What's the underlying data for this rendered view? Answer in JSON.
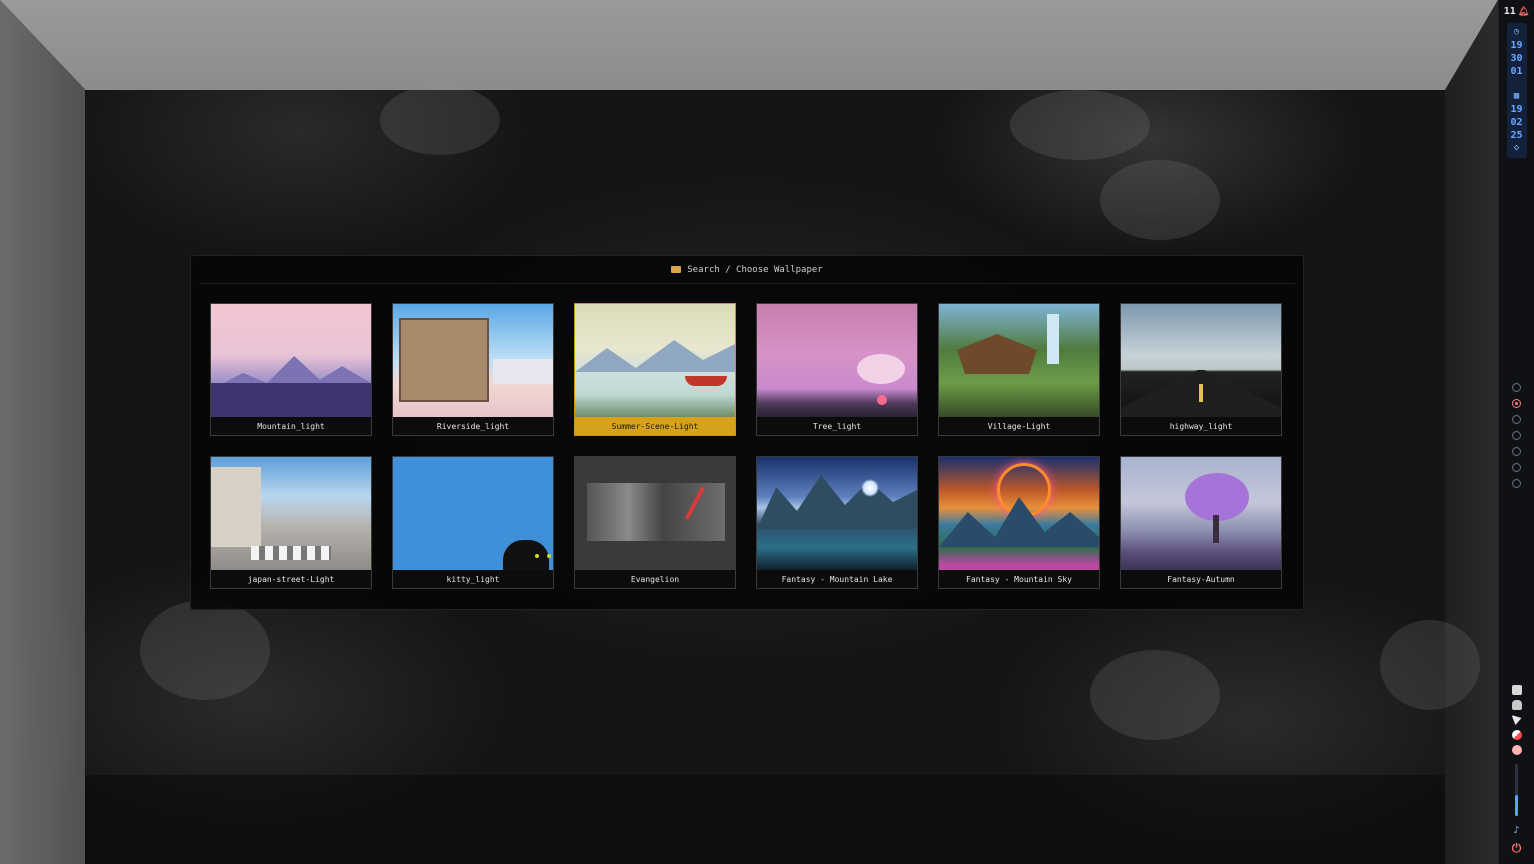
{
  "window": {
    "header_title": "Search / Choose Wallpaper"
  },
  "wallpapers": [
    {
      "label": "Mountain_light",
      "thumb": "t-mountain",
      "selected": false
    },
    {
      "label": "Riverside_light",
      "thumb": "t-riverside",
      "selected": false
    },
    {
      "label": "Summer-Scene-Light",
      "thumb": "t-summer",
      "selected": true
    },
    {
      "label": "Tree_light",
      "thumb": "t-tree",
      "selected": false
    },
    {
      "label": "Village-Light",
      "thumb": "t-village",
      "selected": false
    },
    {
      "label": "highway_light",
      "thumb": "t-highway",
      "selected": false
    },
    {
      "label": "japan-street-Light",
      "thumb": "t-japan",
      "selected": false
    },
    {
      "label": "kitty_light",
      "thumb": "t-kitty",
      "selected": false
    },
    {
      "label": "Evangelion",
      "thumb": "t-evangelion",
      "selected": false
    },
    {
      "label": "Fantasy - Mountain Lake",
      "thumb": "t-lake",
      "selected": false
    },
    {
      "label": "Fantasy - Mountain Sky",
      "thumb": "t-sky",
      "selected": false
    },
    {
      "label": "Fantasy-Autumn",
      "thumb": "t-autumn",
      "selected": false
    }
  ],
  "bar": {
    "workspace_count": "11",
    "bell_icon": "bell-icon",
    "clock_icon": "◷",
    "time": [
      "19",
      "30",
      "01"
    ],
    "calendar_icon": "▦",
    "date": [
      "19",
      "02",
      "25"
    ],
    "drop_icon": "◇",
    "workspaces": [
      false,
      true,
      false,
      false,
      false,
      false,
      false
    ],
    "mic_icon": "♪",
    "power_icon": "⏻",
    "volume_level": 0.4
  },
  "colors": {
    "accent": "#d6a21c",
    "bar_text": "#6aa8ff",
    "active_workspace": "#ff7a7a"
  }
}
